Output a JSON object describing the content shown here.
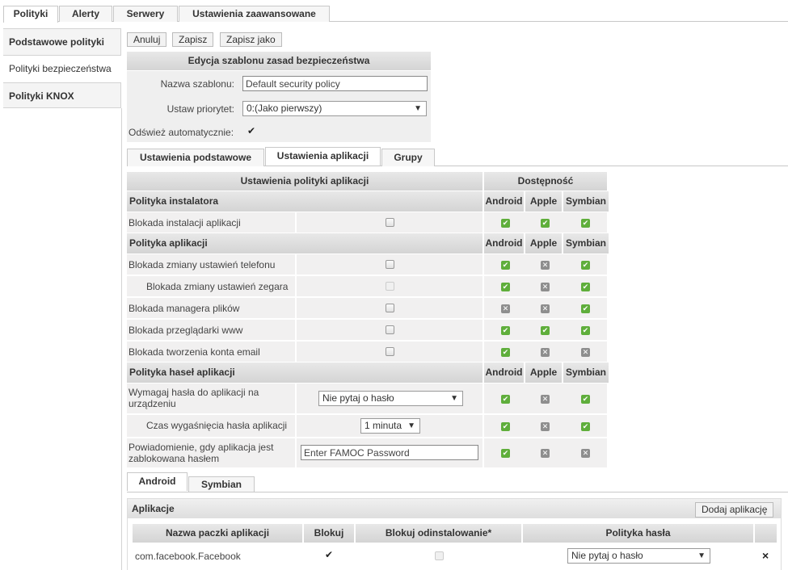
{
  "top_tabs": [
    "Polityki",
    "Alerty",
    "Serwery",
    "Ustawienia zaawansowane"
  ],
  "sidebar": [
    "Podstawowe polityki",
    "Polityki bezpieczeństwa",
    "Polityki KNOX"
  ],
  "toolbar": {
    "cancel": "Anuluj",
    "save": "Zapisz",
    "save_as": "Zapisz jako"
  },
  "template": {
    "title": "Edycja szablonu zasad bezpieczeństwa",
    "name_label": "Nazwa szablonu:",
    "name_value": "Default security policy",
    "priority_label": "Ustaw priorytet:",
    "priority_value": "0:(Jako pierwszy)",
    "refresh_label": "Odśwież automatycznie:",
    "refresh_checked": true
  },
  "sub_tabs": [
    "Ustawienia podstawowe",
    "Ustawienia aplikacji",
    "Grupy"
  ],
  "policy_table": {
    "header_left": "Ustawienia polityki aplikacji",
    "header_right": "Dostępność",
    "platforms": [
      "Android",
      "Apple",
      "Symbian"
    ],
    "sections": [
      {
        "title": "Polityka instalatora",
        "rows": [
          {
            "label": "Blokada instalacji aplikacji",
            "avail": [
              "yes",
              "yes",
              "yes"
            ]
          }
        ]
      },
      {
        "title": "Polityka aplikacji",
        "rows": [
          {
            "label": "Blokada zmiany ustawień telefonu",
            "avail": [
              "yes",
              "no",
              "yes"
            ]
          },
          {
            "label": "Blokada zmiany ustawień zegara",
            "avail": [
              "yes",
              "no",
              "yes"
            ]
          },
          {
            "label": "Blokada managera plików",
            "avail": [
              "no",
              "no",
              "yes"
            ]
          },
          {
            "label": "Blokada przeglądarki www",
            "avail": [
              "yes",
              "yes",
              "yes"
            ]
          },
          {
            "label": "Blokada tworzenia konta email",
            "avail": [
              "yes",
              "no",
              "no"
            ]
          }
        ]
      },
      {
        "title": "Polityka haseł aplikacji",
        "rows": [
          {
            "label_1": "Wymagaj hasła do aplikacji na",
            "label_2": "urządzeniu",
            "value": "Nie pytaj o hasło",
            "avail": [
              "yes",
              "no",
              "yes"
            ]
          },
          {
            "label": "Czas wygaśnięcia hasła aplikacji",
            "value": "1 minuta",
            "avail": [
              "yes",
              "no",
              "yes"
            ]
          },
          {
            "label_1": "Powiadomienie, gdy aplikacja jest",
            "label_2": "zablokowana hasłem",
            "placeholder": "Enter FAMOC Password",
            "avail": [
              "yes",
              "no",
              "no"
            ]
          }
        ]
      }
    ]
  },
  "platform_tabs": [
    "Android",
    "Symbian"
  ],
  "apps": {
    "title": "Aplikacje",
    "add_button": "Dodaj aplikację",
    "columns": [
      "Nazwa paczki aplikacji",
      "Blokuj",
      "Blokuj odinstalowanie*",
      "Polityka hasła"
    ],
    "rows": [
      {
        "package": "com.facebook.Facebook",
        "block": true,
        "block_uninstall": false,
        "password_policy": "Nie pytaj o hasło",
        "remove": "×"
      }
    ]
  }
}
